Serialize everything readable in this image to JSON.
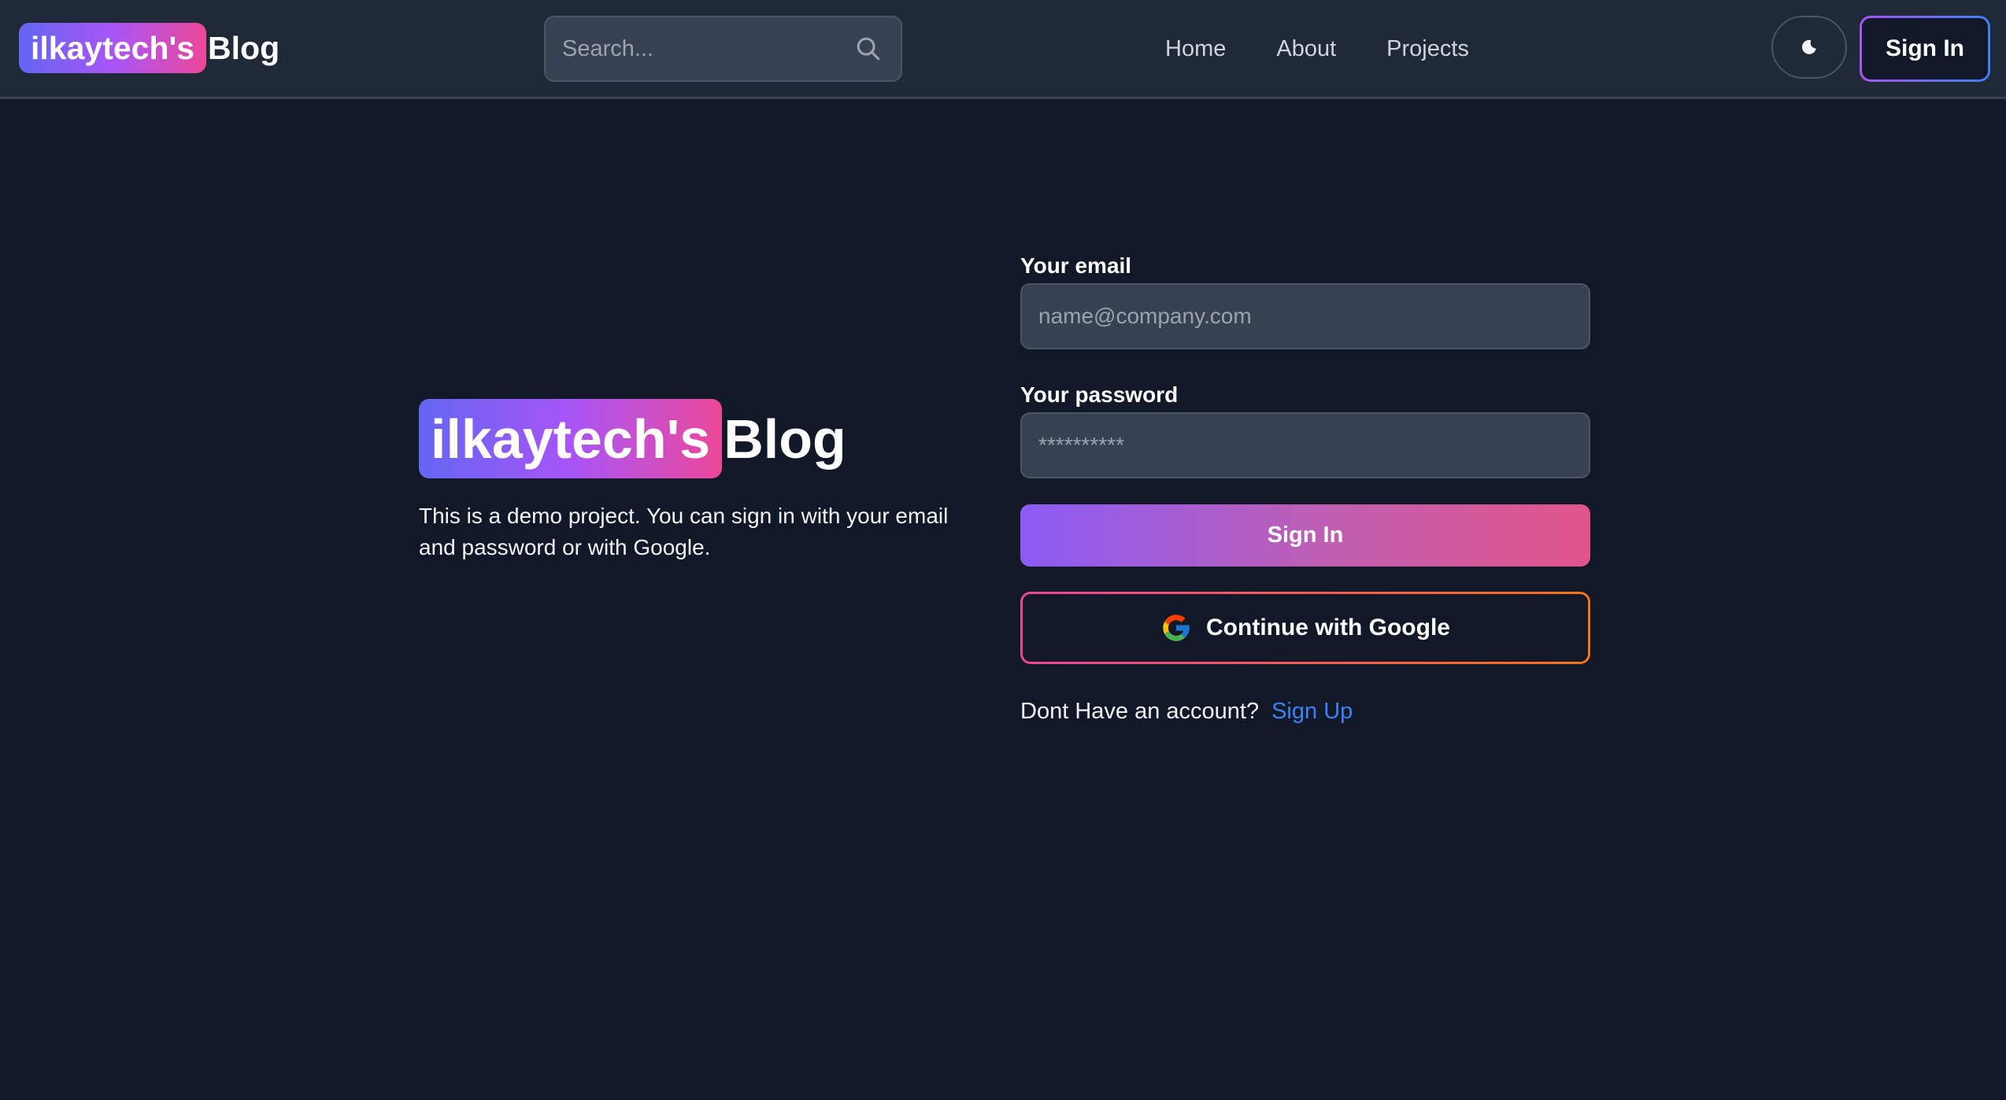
{
  "header": {
    "brand_highlight": "ilkaytech's",
    "brand_rest": "Blog",
    "search_placeholder": "Search...",
    "nav": [
      {
        "label": "Home"
      },
      {
        "label": "About"
      },
      {
        "label": "Projects"
      }
    ],
    "theme_icon": "moon-icon",
    "signin_label": "Sign In"
  },
  "hero": {
    "brand_highlight": "ilkaytech's",
    "brand_rest": "Blog",
    "description": "This is a demo project. You can sign in with your email and password or with Google."
  },
  "form": {
    "email_label": "Your email",
    "email_placeholder": "name@company.com",
    "password_label": "Your password",
    "password_placeholder": "**********",
    "signin_button": "Sign In",
    "google_button": "Continue with Google",
    "google_icon": "google-icon",
    "no_account_text": "Dont Have an account?",
    "signup_link": "Sign Up"
  },
  "colors": {
    "background": "#111827",
    "header_background": "#1f2937",
    "gradient_start": "#6366f1",
    "gradient_mid": "#a855f7",
    "gradient_end": "#ec4899",
    "link": "#3b82f6"
  }
}
